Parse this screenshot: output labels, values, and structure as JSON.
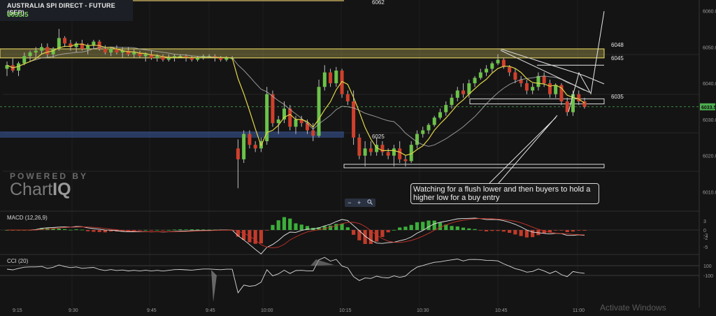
{
  "header": {
    "title": "AUSTRALIA SPI DIRECT - FUTURE (SEP).",
    "last_price": "6033.5"
  },
  "overlays": {
    "top_value": "6062",
    "level_6048": "6048",
    "level_6045": "6045",
    "level_6035": "6035",
    "level_6025": "6025",
    "callout": "Watching for a flush lower and then buyers to hold a higher low for a buy entry",
    "powered_by": "POWERED BY",
    "brand_a": "Chart",
    "brand_b": "IQ",
    "activate": "Activate Windows",
    "zoom_minus": "−",
    "zoom_plus": "+",
    "zoom_icon": "magnifier-icon"
  },
  "colors": {
    "up": "#6cc24a",
    "down": "#d0402c",
    "yellow_zone": "#f3e36a",
    "blue_zone": "#3a5aa0",
    "ma_fast": "#e0d54a",
    "ma_slow": "#b5b5b5",
    "grid": "#262626",
    "axis": "#9a9a9a"
  },
  "chart_data": [
    {
      "type": "line",
      "title": "AUSTRALIA SPI DIRECT - FUTURE (SEP).",
      "subtype": "candlestick",
      "x_ticks": [
        "9:15",
        "9:30",
        "9:45",
        "9:45",
        "10:00",
        "10:15",
        "10:30",
        "10:45",
        "11:00"
      ],
      "y_ticks": [
        6060.0,
        6050.0,
        6040.0,
        6030.0,
        6020.0,
        6010.0
      ],
      "ylim": [
        6007,
        6063
      ],
      "last_price_label": "6033.5",
      "levels": [
        {
          "label": "6048",
          "value": 6048,
          "style": "yellow zone"
        },
        {
          "label": "6045",
          "value": 6045,
          "style": "line"
        },
        {
          "label": "6035",
          "value": 6035,
          "style": "box"
        },
        {
          "label": "6025",
          "value": 6017,
          "style": "box"
        }
      ],
      "candles_ohlc": [
        [
          6044,
          6046,
          6042,
          6045
        ],
        [
          6045,
          6047,
          6043,
          6043.5
        ],
        [
          6043.5,
          6046,
          6042,
          6045.5
        ],
        [
          6045.5,
          6048.5,
          6045,
          6047.5
        ],
        [
          6047.5,
          6049,
          6046,
          6048.5
        ],
        [
          6048.5,
          6050,
          6047,
          6049
        ],
        [
          6049,
          6051,
          6048,
          6050
        ],
        [
          6050,
          6051,
          6047,
          6048
        ],
        [
          6048,
          6050,
          6047,
          6049.5
        ],
        [
          6049.5,
          6055,
          6049,
          6052.5
        ],
        [
          6052.5,
          6053,
          6050,
          6051
        ],
        [
          6051,
          6052,
          6049,
          6050
        ],
        [
          6050,
          6051.5,
          6048.5,
          6051
        ],
        [
          6051,
          6052,
          6049,
          6049.5
        ],
        [
          6049.5,
          6051,
          6048,
          6050.5
        ],
        [
          6050.5,
          6052,
          6049.5,
          6051.5
        ],
        [
          6051.5,
          6052,
          6049,
          6049.5
        ],
        [
          6049.5,
          6050.5,
          6048,
          6048.5
        ],
        [
          6048.5,
          6050,
          6047.5,
          6049.5
        ],
        [
          6049.5,
          6050.5,
          6048,
          6048.5
        ],
        [
          6048.5,
          6050,
          6047,
          6049
        ],
        [
          6049,
          6050,
          6047.5,
          6048
        ],
        [
          6048,
          6049.5,
          6047,
          6048.5
        ],
        [
          6048.5,
          6049,
          6047,
          6047.5
        ],
        [
          6047.5,
          6048.5,
          6046,
          6048
        ],
        [
          6048,
          6049,
          6046.5,
          6047
        ],
        [
          6047,
          6048,
          6046,
          6047.5
        ],
        [
          6047.5,
          6048,
          6046,
          6046.5
        ],
        [
          6046.5,
          6048,
          6046,
          6047
        ],
        [
          6047,
          6048,
          6046,
          6047.5
        ],
        [
          6047.5,
          6048,
          6047,
          6047.5
        ],
        [
          6047.5,
          6048,
          6046,
          6047
        ],
        [
          6047,
          6047.5,
          6046,
          6046.5
        ],
        [
          6046.5,
          6047.5,
          6046,
          6047
        ],
        [
          6047,
          6048,
          6046.5,
          6047.5
        ],
        [
          6047.5,
          6048,
          6047,
          6047.5
        ],
        [
          6047.5,
          6048,
          6046,
          6047
        ],
        [
          6047,
          6047.5,
          6046,
          6046.5
        ],
        [
          6046.5,
          6047.5,
          6046,
          6047
        ],
        [
          6047,
          6047.5,
          6046.5,
          6047
        ],
        [
          6022,
          6024.5,
          6011,
          6019
        ],
        [
          6019,
          6027,
          6018,
          6026
        ],
        [
          6026,
          6027,
          6022,
          6023
        ],
        [
          6023,
          6024,
          6021,
          6022
        ],
        [
          6022,
          6025,
          6021,
          6024
        ],
        [
          6024,
          6039,
          6023,
          6037
        ],
        [
          6037,
          6038,
          6028,
          6029
        ],
        [
          6029,
          6031,
          6026,
          6030
        ],
        [
          6030,
          6035,
          6029,
          6033
        ],
        [
          6033,
          6034,
          6027,
          6028
        ],
        [
          6028,
          6031,
          6026,
          6030
        ],
        [
          6030,
          6031,
          6028,
          6029
        ],
        [
          6029,
          6030,
          6026,
          6027
        ],
        [
          6027,
          6029,
          6024,
          6025.5
        ],
        [
          6025.5,
          6041,
          6025,
          6039
        ],
        [
          6039,
          6045,
          6038,
          6043
        ],
        [
          6043,
          6044,
          6039,
          6040
        ],
        [
          6040,
          6044.5,
          6039,
          6043.5
        ],
        [
          6043.5,
          6044,
          6036,
          6037
        ],
        [
          6037,
          6038,
          6034,
          6035
        ],
        [
          6035,
          6038,
          6023,
          6025
        ],
        [
          6025,
          6026,
          6019,
          6020
        ],
        [
          6020,
          6024,
          6017,
          6022
        ],
        [
          6022,
          6024,
          6020,
          6021
        ],
        [
          6021,
          6025,
          6020,
          6023
        ],
        [
          6023,
          6024,
          6020,
          6021
        ],
        [
          6021,
          6022,
          6019,
          6020
        ],
        [
          6020,
          6023,
          6017,
          6022
        ],
        [
          6022,
          6024,
          6018,
          6019
        ],
        [
          6019,
          6020,
          6017,
          6018.5
        ],
        [
          6018.5,
          6024,
          6018,
          6023
        ],
        [
          6023,
          6027,
          6022,
          6026
        ],
        [
          6026,
          6028,
          6025,
          6027
        ],
        [
          6027,
          6029,
          6026,
          6028.5
        ],
        [
          6028.5,
          6031,
          6028,
          6030.5
        ],
        [
          6030.5,
          6033,
          6030,
          6032
        ],
        [
          6032,
          6035,
          6031,
          6034
        ],
        [
          6034,
          6037,
          6033,
          6036
        ],
        [
          6036,
          6039,
          6035,
          6038
        ],
        [
          6038,
          6040,
          6036,
          6037
        ],
        [
          6037,
          6041,
          6036,
          6040
        ],
        [
          6040,
          6042,
          6039,
          6041.5
        ],
        [
          6041.5,
          6044,
          6041,
          6043
        ],
        [
          6043,
          6045,
          6042,
          6044
        ],
        [
          6044,
          6046,
          6043,
          6045.5
        ],
        [
          6045.5,
          6048,
          6045,
          6046.5
        ],
        [
          6046.5,
          6047,
          6044,
          6044.5
        ],
        [
          6044.5,
          6045,
          6042,
          6043
        ],
        [
          6043,
          6044,
          6040,
          6041
        ],
        [
          6041,
          6042,
          6039,
          6040
        ],
        [
          6040,
          6041,
          6037,
          6038
        ],
        [
          6038,
          6040,
          6037,
          6039
        ],
        [
          6039,
          6043,
          6038,
          6042
        ],
        [
          6042,
          6043,
          6039,
          6040
        ],
        [
          6040,
          6041,
          6036,
          6037
        ],
        [
          6037,
          6040,
          6036,
          6039.5
        ],
        [
          6039.5,
          6040,
          6034,
          6035
        ],
        [
          6035,
          6036,
          6031,
          6032
        ],
        [
          6032,
          6038,
          6031,
          6037
        ],
        [
          6037,
          6038,
          6034,
          6035
        ],
        [
          6035,
          6036,
          6033,
          6033.5
        ]
      ]
    },
    {
      "type": "bar",
      "title": "MACD (12,26,9)",
      "y_ticks": [
        3,
        0,
        -3,
        -2,
        -5
      ],
      "note": "histogram with MACD and signal lines"
    },
    {
      "type": "line",
      "title": "CCI (20)",
      "y_ticks": [
        100,
        -100
      ]
    }
  ]
}
